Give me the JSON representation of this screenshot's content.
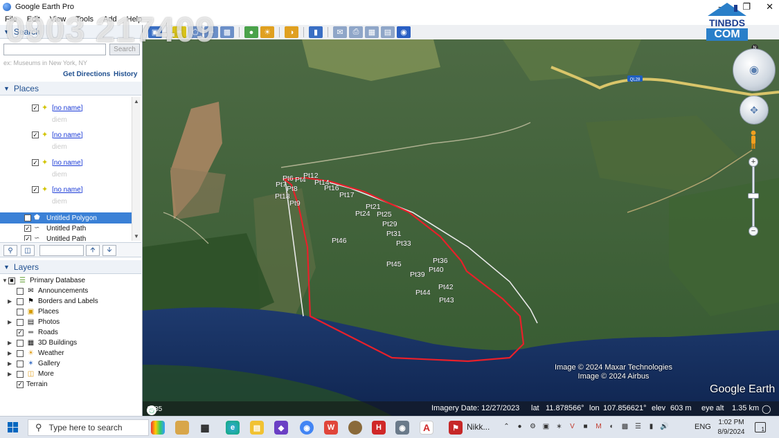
{
  "window": {
    "title": "Google Earth Pro",
    "controls": [
      "—",
      "❐",
      "✕"
    ]
  },
  "menu": [
    "File",
    "Edit",
    "View",
    "Tools",
    "Add",
    "Help"
  ],
  "watermark": "0903 217409",
  "brand": {
    "top": "TINBDS",
    "bottom": "COM"
  },
  "search": {
    "header": "Search",
    "placeholder": "",
    "button": "Search",
    "hint": "ex: Museums in New York, NY",
    "get_directions": "Get Directions",
    "history": "History"
  },
  "places": {
    "header": "Places",
    "items": [
      {
        "label": "[no name]",
        "sub": "diem"
      },
      {
        "label": "[no name]",
        "sub": "diem"
      },
      {
        "label": "[no name]",
        "sub": "diem"
      },
      {
        "label": "[no name]",
        "sub": "diem"
      }
    ],
    "polygon": "Untitled Polygon",
    "paths": [
      "Untitled Path",
      "Untitled Path"
    ]
  },
  "layers": {
    "header": "Layers",
    "root": "Primary Database",
    "items": [
      "Announcements",
      "Borders and Labels",
      "Places",
      "Photos",
      "Roads",
      "3D Buildings",
      "Weather",
      "Gallery",
      "More"
    ],
    "terrain": "Terrain"
  },
  "map": {
    "road_label": "QL28",
    "points": [
      "Pt6",
      "Pt7",
      "Pt4",
      "Pt12",
      "Pt14",
      "Pt8",
      "Pt16",
      "Pt18",
      "Pt9",
      "Pt17",
      "Pt21",
      "Pt24",
      "Pt25",
      "Pt29",
      "Pt31",
      "Pt33",
      "Pt46",
      "Pt36",
      "Pt45",
      "Pt40",
      "Pt39",
      "Pt42",
      "Pt44",
      "Pt43"
    ],
    "credits": [
      "Image © 2024 Maxar Technologies",
      "Image © 2024 Airbus"
    ],
    "logo": "Google Earth",
    "nav_north": "N"
  },
  "status": {
    "year": "1985",
    "imagery_date": "Imagery Date: 12/27/2023",
    "lat_label": "lat",
    "lat": "11.878566°",
    "lon_label": "lon",
    "lon": "107.856621°",
    "elev_label": "elev",
    "elev": "603 m",
    "eye_label": "eye alt",
    "eye": "1.35 km"
  },
  "taskbar": {
    "search_placeholder": "Type here to search",
    "app_label": "Nikk...",
    "lang": "ENG",
    "time": "1:02 PM",
    "date": "8/9/2024",
    "notif_count": "1"
  },
  "colors": {
    "polygon_outline": "#e8202a",
    "path_line": "#e8e8e8",
    "selection": "#3a80d6",
    "panel_header": "#1f4f8f"
  }
}
